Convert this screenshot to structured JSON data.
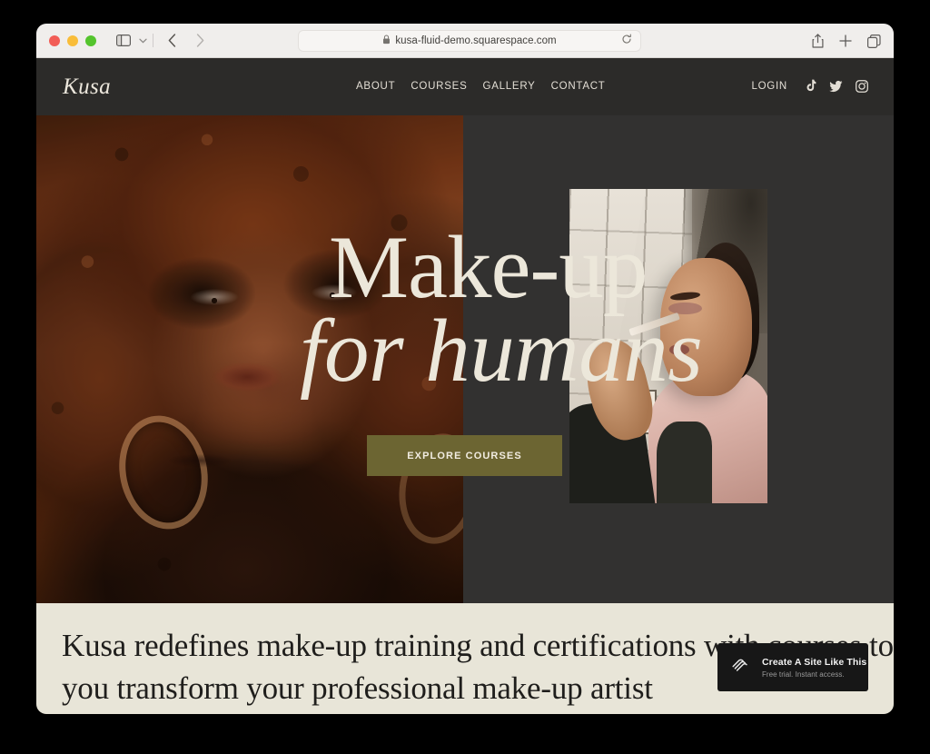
{
  "browser": {
    "url": "kusa-fluid-demo.squarespace.com",
    "lock_icon": "lock-icon",
    "reload_icon": "reload-icon",
    "sidebar_icon": "sidebar-toggle-icon",
    "chevron_icon": "chevron-down-icon",
    "back_icon": "back-arrow-icon",
    "forward_icon": "forward-arrow-icon",
    "share_icon": "share-icon",
    "new_tab_icon": "plus-icon",
    "tabs_icon": "tab-overview-icon",
    "traffic_lights": [
      "close-red",
      "minimize-yellow",
      "zoom-green"
    ]
  },
  "site": {
    "logo": "Kusa",
    "nav": [
      {
        "label": "ABOUT"
      },
      {
        "label": "COURSES"
      },
      {
        "label": "GALLERY"
      },
      {
        "label": "CONTACT"
      }
    ],
    "login_label": "LOGIN",
    "social": [
      {
        "name": "tiktok-icon"
      },
      {
        "name": "twitter-icon"
      },
      {
        "name": "instagram-icon"
      }
    ],
    "hero": {
      "title_line1": "Make-up",
      "title_line2": "for humans",
      "cta_label": "EXPLORE COURSES",
      "image_left_alt": "portrait-of-woman-with-curly-hair",
      "image_right_alt": "makeup-artist-applying-eye-makeup"
    },
    "intro": {
      "paragraph": "Kusa redefines make-up training and certifications with courses to help you transform your professional make-up artist"
    }
  },
  "badge": {
    "logo_icon": "squarespace-logo-icon",
    "title": "Create A Site Like This",
    "subtitle": "Free trial. Instant access."
  },
  "colors": {
    "site_bg": "#2c2b29",
    "hero_bg": "#323130",
    "cream": "#e8e5d8",
    "cta": "#6c6532",
    "text_light": "#ece7da",
    "badge_bg": "#171717"
  }
}
